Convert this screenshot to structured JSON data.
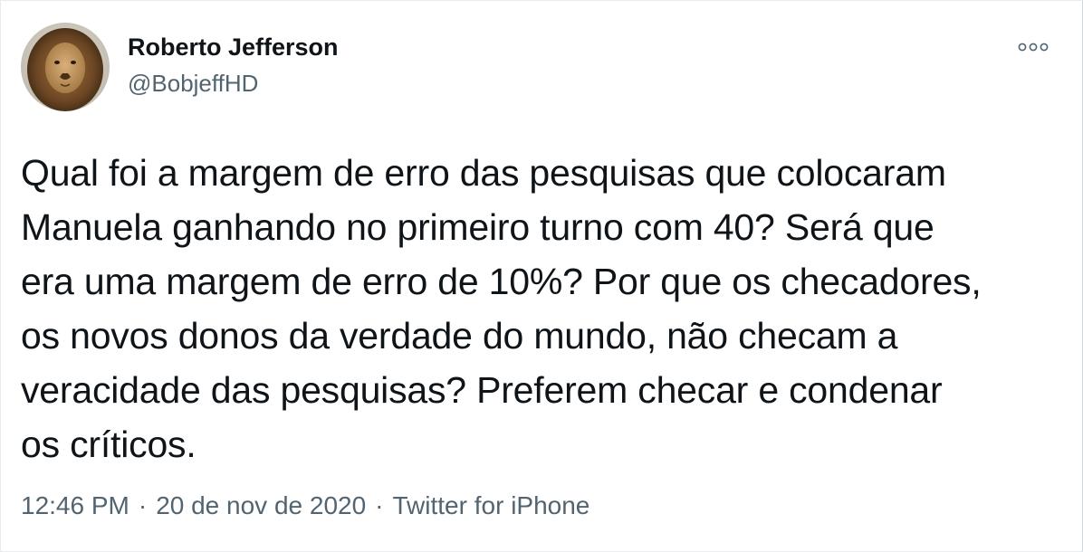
{
  "author": {
    "name": "Roberto Jefferson",
    "handle": "@BobjeffHD",
    "avatar": "lion-photo"
  },
  "more_icon": "more-horizontal-icon",
  "tweet": {
    "text": "Qual foi a margem de erro das pesquisas que colocaram\nManuela ganhando no primeiro turno com 40? Será que\nera uma margem de erro de 10%? Por que os checadores,\nos novos donos da verdade do mundo, não checam a\nveracidade das pesquisas? Preferem checar e condenar\nos críticos."
  },
  "meta": {
    "time": "12:46 PM",
    "separator": "·",
    "date": "20 de nov de 2020",
    "source": "Twitter for iPhone"
  },
  "colors": {
    "text": "#0f1419",
    "secondary": "#536471"
  }
}
